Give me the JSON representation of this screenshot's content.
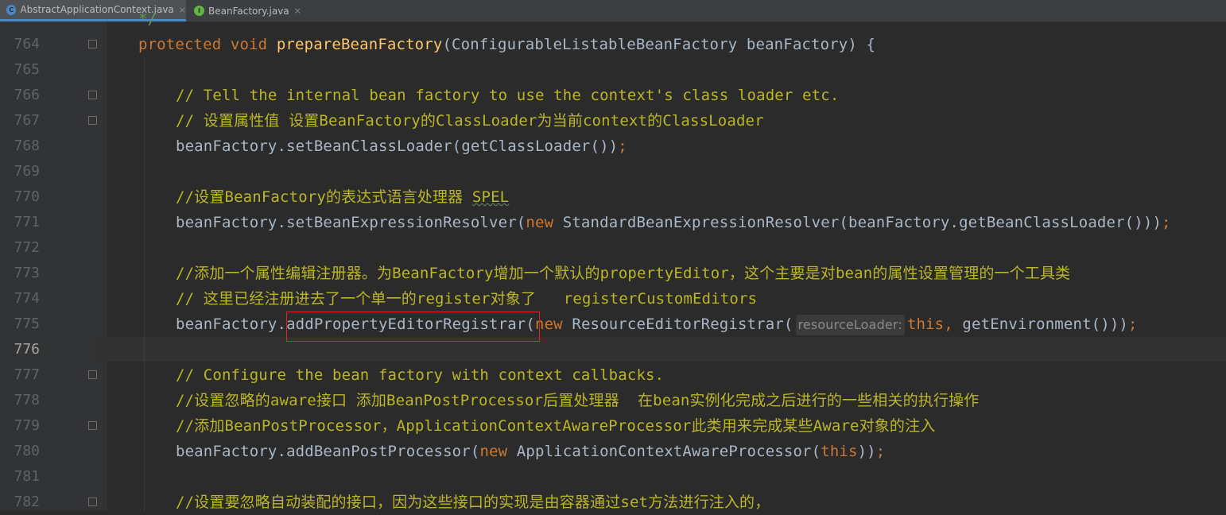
{
  "tabs": [
    {
      "icon": "class-icon",
      "label": "AbstractApplicationContext.java",
      "close": "×",
      "active": true
    },
    {
      "icon": "interface-icon",
      "label": "BeanFactory.java",
      "close": "×",
      "active": false
    }
  ],
  "editor": {
    "partial_top_text": "*/",
    "lines": [
      {
        "num": "764",
        "parts": [
          [
            "kw",
            "protected void "
          ],
          [
            "fn",
            "prepareBeanFactory"
          ],
          [
            "p",
            "(ConfigurableListableBeanFactory beanFactory) {"
          ]
        ]
      },
      {
        "num": "765",
        "parts": []
      },
      {
        "num": "766",
        "parts": [
          [
            "cm",
            "// Tell the internal bean factory to use the context's class loader etc."
          ]
        ]
      },
      {
        "num": "767",
        "parts": [
          [
            "cm",
            "// 设置属性值 设置BeanFactory的ClassLoader为当前context的ClassLoader"
          ]
        ]
      },
      {
        "num": "768",
        "parts": [
          [
            "p",
            "beanFactory.setBeanClassLoader(getClassLoader())"
          ],
          [
            "kw",
            ";"
          ]
        ]
      },
      {
        "num": "769",
        "parts": []
      },
      {
        "num": "770",
        "parts": [
          [
            "cm",
            "//设置BeanFactory的表达式语言处理器 "
          ],
          [
            "cmsq",
            "SPEL"
          ]
        ]
      },
      {
        "num": "771",
        "parts": [
          [
            "p",
            "beanFactory.setBeanExpressionResolver("
          ],
          [
            "kw",
            "new "
          ],
          [
            "p",
            "StandardBeanExpressionResolver(beanFactory.getBeanClassLoader()))"
          ],
          [
            "kw",
            ";"
          ]
        ]
      },
      {
        "num": "772",
        "parts": []
      },
      {
        "num": "773",
        "parts": [
          [
            "cm",
            "//添加一个属性编辑注册器。为BeanFactory增加一个默认的propertyEditor，这个主要是对bean的属性设置管理的一个工具类"
          ]
        ]
      },
      {
        "num": "774",
        "parts": [
          [
            "cm",
            "// 这里已经注册进去了一个单一的register对象了   registerCustomEditors"
          ]
        ]
      },
      {
        "num": "775",
        "parts": [
          [
            "p",
            "beanFactory."
          ],
          [
            "p",
            "addPropertyEditorRegistrar"
          ],
          [
            "p",
            "("
          ],
          [
            "kw",
            "new "
          ],
          [
            "p",
            "ResourceEditorRegistrar("
          ],
          [
            "hint",
            "resourceLoader:"
          ],
          [
            "kw",
            "this, "
          ],
          [
            "p",
            "getEnvironment()))"
          ],
          [
            "kw",
            ";"
          ]
        ]
      },
      {
        "num": "776",
        "parts": []
      },
      {
        "num": "777",
        "parts": [
          [
            "cm",
            "// Configure the bean factory with context callbacks."
          ]
        ]
      },
      {
        "num": "778",
        "parts": [
          [
            "cm",
            "//设置忽略的aware接口 添加BeanPostProcessor后置处理器  在bean实例化完成之后进行的一些相关的执行操作"
          ]
        ]
      },
      {
        "num": "779",
        "parts": [
          [
            "cm",
            "//添加BeanPostProcessor，ApplicationContextAwareProcessor此类用来完成某些Aware对象的注入"
          ]
        ]
      },
      {
        "num": "780",
        "parts": [
          [
            "p",
            "beanFactory.addBeanPostProcessor("
          ],
          [
            "kw",
            "new "
          ],
          [
            "p",
            "ApplicationContextAwareProcessor("
          ],
          [
            "kw",
            "this"
          ],
          [
            "p",
            "))"
          ],
          [
            "kw",
            ";"
          ]
        ]
      },
      {
        "num": "781",
        "parts": []
      },
      {
        "num": "782",
        "parts": [
          [
            "cm",
            "//设置要忽略自动装配的接口，因为这些接口的实现是由容器通过set方法进行注入的，"
          ]
        ]
      }
    ],
    "current_line": "776",
    "highlighted_token": "addPropertyEditorRegistrar"
  },
  "colors": {
    "background": "#2b2b2b",
    "gutter": "#313335",
    "keyword": "#cc7832",
    "method": "#ffc66d",
    "comment": "#bbb529",
    "text": "#a9b7c6",
    "highlight_box": "#e2231a"
  }
}
